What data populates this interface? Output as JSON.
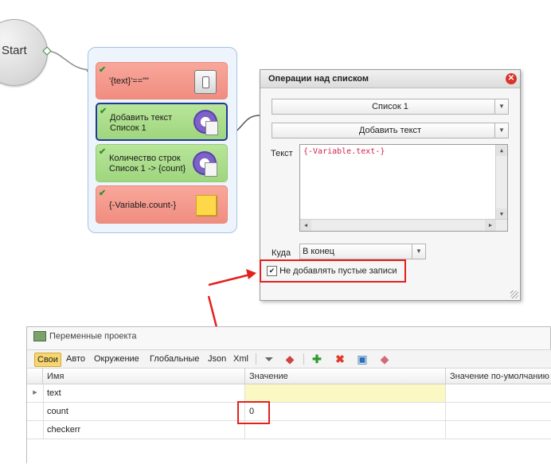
{
  "start_node": {
    "label": "Start"
  },
  "actions": [
    {
      "label_lines": [
        "'{text}'==\"\""
      ],
      "color": "red",
      "icon": "switch-icon"
    },
    {
      "label_lines": [
        "Добавить текст",
        "Список 1"
      ],
      "color": "green",
      "icon": "gear-icon",
      "selected": true
    },
    {
      "label_lines": [
        "Количество строк",
        "Список 1 -> {count}"
      ],
      "color": "green",
      "icon": "gear-icon"
    },
    {
      "label_lines": [
        "{-Variable.count-}"
      ],
      "color": "red",
      "icon": "note-icon"
    }
  ],
  "dialog": {
    "title": "Операции над списком",
    "list_select": "Список 1",
    "operation_select": "Добавить текст",
    "text_label": "Текст",
    "text_value": "{-Variable.text-}",
    "where_label": "Куда",
    "where_value": "В конец",
    "skip_empty_label": "Не добавлять пустые записи",
    "skip_empty_checked": true
  },
  "variables_panel": {
    "title": "Переменные проекта",
    "tabs": [
      "Свои",
      "Авто",
      "Окружение",
      "Глобальные",
      "Json",
      "Xml"
    ],
    "active_tab": "Свои",
    "toolbar_icons": [
      "filter-icon",
      "eraser-icon",
      "add-icon",
      "delete-icon",
      "edit-icon",
      "clear-icon"
    ],
    "columns": [
      "Имя",
      "Значение",
      "Значение по-умолчанию"
    ],
    "rows": [
      {
        "name": "text",
        "value": "",
        "default": ""
      },
      {
        "name": "count",
        "value": "0",
        "default": ""
      },
      {
        "name": "checkerr",
        "value": "",
        "default": ""
      }
    ]
  },
  "colors": {
    "highlight": "#e3211d",
    "selected_border": "#1d3a9a",
    "red_block": "#f4998c",
    "green_block": "#a9dc89"
  }
}
